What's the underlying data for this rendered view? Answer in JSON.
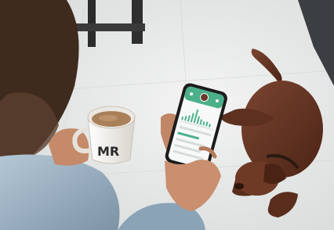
{
  "scene": {
    "mug_monogram": "MR",
    "phone_app": {
      "accent_color": "#4bb08a",
      "screen_background": "#f7f9f8"
    },
    "colors": {
      "floor": "#e9ebea",
      "dog_fur": "#6b3a26",
      "mug": "#f4f1ec",
      "coffee": "#a9805a",
      "sleeve": "#9fb6c8",
      "skin": "#c98f6f",
      "hair": "#4a3424"
    }
  }
}
